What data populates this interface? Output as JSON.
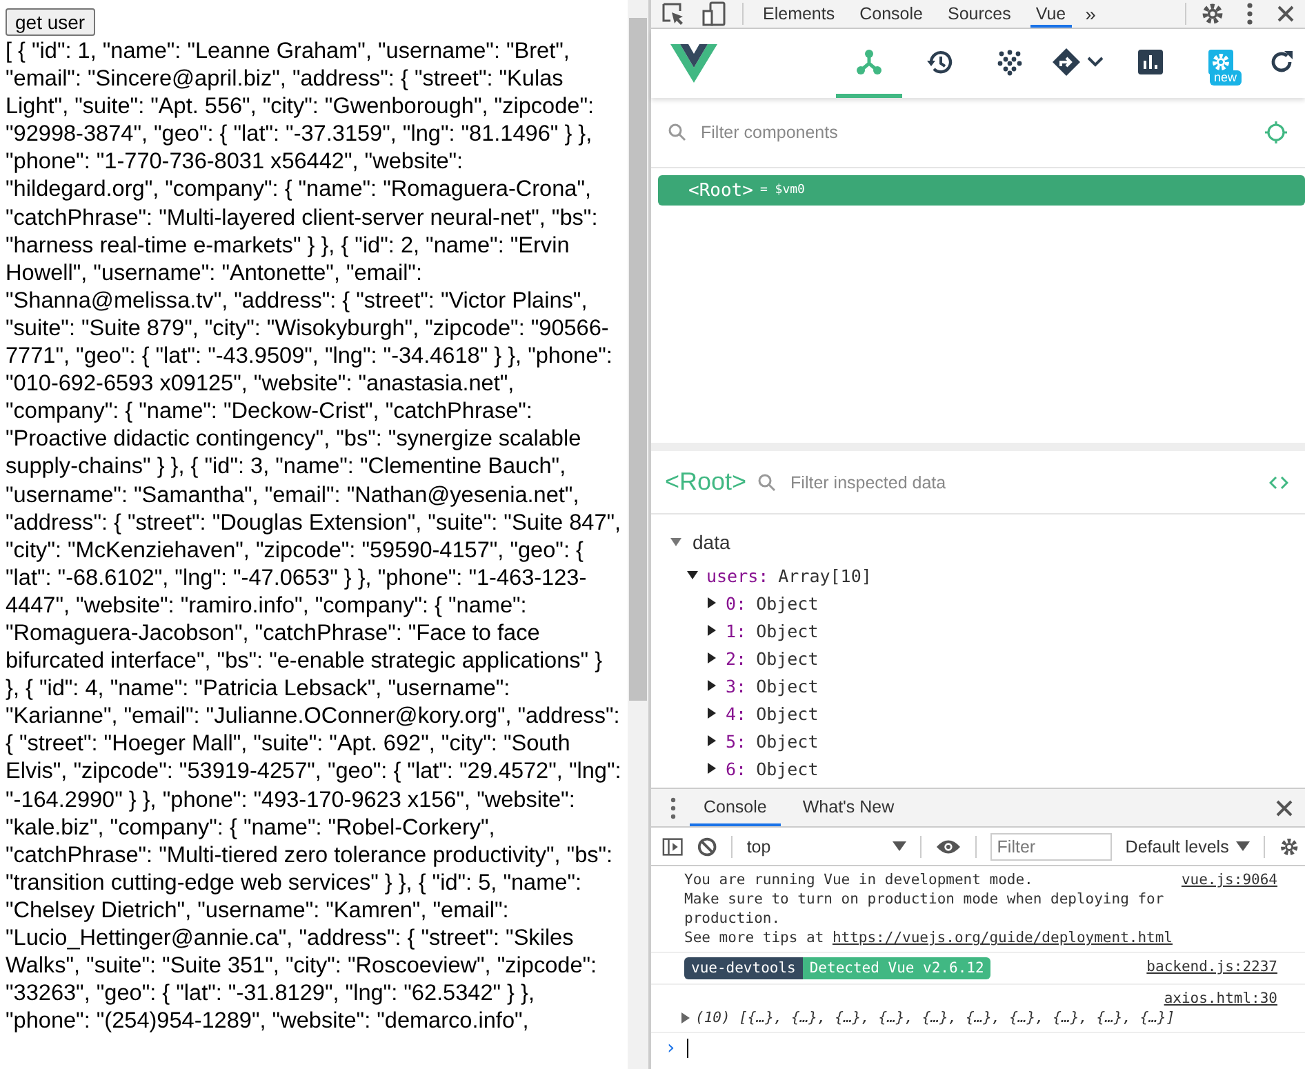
{
  "page": {
    "button": "get user",
    "output": "[ { \"id\": 1, \"name\": \"Leanne Graham\", \"username\": \"Bret\", \"email\": \"Sincere@april.biz\", \"address\": { \"street\": \"Kulas Light\", \"suite\": \"Apt. 556\", \"city\": \"Gwenborough\", \"zipcode\": \"92998-3874\", \"geo\": { \"lat\": \"-37.3159\", \"lng\": \"81.1496\" } }, \"phone\": \"1-770-736-8031 x56442\", \"website\": \"hildegard.org\", \"company\": { \"name\": \"Romaguera-Crona\", \"catchPhrase\": \"Multi-layered client-server neural-net\", \"bs\": \"harness real-time e-markets\" } }, { \"id\": 2, \"name\": \"Ervin Howell\", \"username\": \"Antonette\", \"email\": \"Shanna@melissa.tv\", \"address\": { \"street\": \"Victor Plains\", \"suite\": \"Suite 879\", \"city\": \"Wisokyburgh\", \"zipcode\": \"90566-7771\", \"geo\": { \"lat\": \"-43.9509\", \"lng\": \"-34.4618\" } }, \"phone\": \"010-692-6593 x09125\", \"website\": \"anastasia.net\", \"company\": { \"name\": \"Deckow-Crist\", \"catchPhrase\": \"Proactive didactic contingency\", \"bs\": \"synergize scalable supply-chains\" } }, { \"id\": 3, \"name\": \"Clementine Bauch\", \"username\": \"Samantha\", \"email\": \"Nathan@yesenia.net\", \"address\": { \"street\": \"Douglas Extension\", \"suite\": \"Suite 847\", \"city\": \"McKenziehaven\", \"zipcode\": \"59590-4157\", \"geo\": { \"lat\": \"-68.6102\", \"lng\": \"-47.0653\" } }, \"phone\": \"1-463-123-4447\", \"website\": \"ramiro.info\", \"company\": { \"name\": \"Romaguera-Jacobson\", \"catchPhrase\": \"Face to face bifurcated interface\", \"bs\": \"e-enable strategic applications\" } }, { \"id\": 4, \"name\": \"Patricia Lebsack\", \"username\": \"Karianne\", \"email\": \"Julianne.OConner@kory.org\", \"address\": { \"street\": \"Hoeger Mall\", \"suite\": \"Apt. 692\", \"city\": \"South Elvis\", \"zipcode\": \"53919-4257\", \"geo\": { \"lat\": \"29.4572\", \"lng\": \"-164.2990\" } }, \"phone\": \"493-170-9623 x156\", \"website\": \"kale.biz\", \"company\": { \"name\": \"Robel-Corkery\", \"catchPhrase\": \"Multi-tiered zero tolerance productivity\", \"bs\": \"transition cutting-edge web services\" } }, { \"id\": 5, \"name\": \"Chelsey Dietrich\", \"username\": \"Kamren\", \"email\": \"Lucio_Hettinger@annie.ca\", \"address\": { \"street\": \"Skiles Walks\", \"suite\": \"Suite 351\", \"city\": \"Roscoeview\", \"zipcode\": \"33263\", \"geo\": { \"lat\": \"-31.8129\", \"lng\": \"62.5342\" } }, \"phone\": \"(254)954-1289\", \"website\": \"demarco.info\","
  },
  "devtools": {
    "tabs": [
      {
        "label": "Elements",
        "selected": false
      },
      {
        "label": "Console",
        "selected": false
      },
      {
        "label": "Sources",
        "selected": false
      },
      {
        "label": "Vue",
        "selected": true
      }
    ],
    "more": "»",
    "vue_toolbar": [
      {
        "kind": "components",
        "selected": true
      },
      {
        "kind": "history",
        "selected": false
      },
      {
        "kind": "vuex",
        "selected": false
      },
      {
        "kind": "routing",
        "selected": false
      },
      {
        "kind": "performance",
        "selected": false
      },
      {
        "kind": "settings",
        "selected": false,
        "badge": "new"
      },
      {
        "kind": "refresh",
        "selected": false
      }
    ],
    "component_filter": {
      "placeholder": "Filter components"
    },
    "tree": [
      {
        "name": "<Root>",
        "ref": "= $vm0",
        "selected": true
      }
    ],
    "inspector": {
      "title": "<Root>",
      "filter": {
        "placeholder": "Filter inspected data"
      },
      "sections": [
        {
          "label": "data",
          "expanded": true,
          "children": [
            {
              "key": "users:",
              "value": "Array[10]",
              "expanded": true,
              "children": [
                {
                  "key": "0:",
                  "value": "Object",
                  "expanded": false
                },
                {
                  "key": "1:",
                  "value": "Object",
                  "expanded": false
                },
                {
                  "key": "2:",
                  "value": "Object",
                  "expanded": false
                },
                {
                  "key": "3:",
                  "value": "Object",
                  "expanded": false
                },
                {
                  "key": "4:",
                  "value": "Object",
                  "expanded": false
                },
                {
                  "key": "5:",
                  "value": "Object",
                  "expanded": false
                },
                {
                  "key": "6:",
                  "value": "Object",
                  "expanded": false
                }
              ]
            }
          ]
        }
      ]
    },
    "drawer": {
      "tabs": [
        {
          "label": "Console",
          "selected": true
        },
        {
          "label": "What's New",
          "selected": false
        }
      ],
      "context": "top",
      "filter": {
        "placeholder": "Filter"
      },
      "levels": "Default levels",
      "messages": [
        {
          "kind": "text",
          "lines": [
            "You are running Vue in development mode.",
            "Make sure to turn on production mode when deploying for production."
          ],
          "tip": "See more tips at",
          "link": "https://vuejs.org/guide/deployment.html",
          "source": "vue.js:9064"
        },
        {
          "kind": "badge",
          "left": "vue-devtools",
          "right": "Detected Vue v2.6.12",
          "source": "backend.js:2237"
        },
        {
          "kind": "log",
          "source": "axios.html:30",
          "count": "(10)",
          "text": "[{…}, {…}, {…}, {…}, {…}, {…}, {…}, {…}, {…}, {…}]",
          "expanded": false
        }
      ],
      "prompt": "›"
    }
  }
}
